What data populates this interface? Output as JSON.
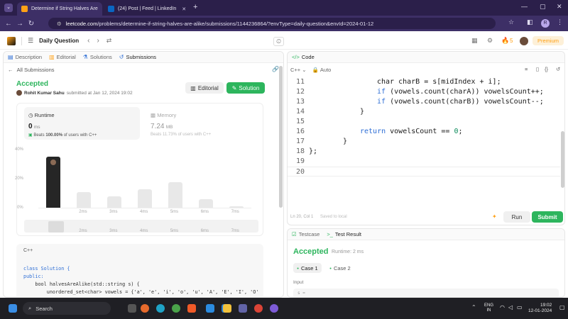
{
  "browser": {
    "tabs": [
      {
        "title": "Determine if String Halves Are",
        "color": "#ffa116"
      },
      {
        "title": "(24) Post | Feed | LinkedIn",
        "color": "#0a66c2"
      }
    ],
    "url_host": "leetcode.com",
    "url_path": "/problems/determine-if-string-halves-are-alike/submissions/1144236864/?envType=daily-question&envId=2024-01-12",
    "profile_letter": "R"
  },
  "topbar": {
    "daily_label": "Daily Question",
    "streak": "5",
    "premium_label": "Premium"
  },
  "left": {
    "tabs": {
      "description": "Description",
      "editorial": "Editorial",
      "solutions": "Solutions",
      "submissions": "Submissions"
    },
    "back_label": "All Submissions",
    "status": "Accepted",
    "author": "Rohit Kumar Sahu",
    "submitted_text": "submitted at Jan 12, 2024 19:02",
    "editorial_btn": "Editorial",
    "solution_btn": "Solution",
    "runtime": {
      "label": "Runtime",
      "value": "0",
      "unit": "ms",
      "beats_label": "Beats",
      "beats_value": "100.00%",
      "beats_suffix": "of users with C++"
    },
    "memory": {
      "label": "Memory",
      "value": "7.24",
      "unit": "MB",
      "beats_text": "Beats 11.73% of users with C++"
    },
    "chart_y": [
      "40%",
      "20%",
      "0%"
    ],
    "chart_x": [
      "2ms",
      "3ms",
      "4ms",
      "5ms",
      "6ms",
      "7ms"
    ],
    "lang": "C++",
    "code_lines": [
      "class Solution {",
      "public:",
      "    bool halvesAreAlike(std::string s) {",
      "        unordered_set<char> vowels = {'a', 'e', 'i', 'o', 'u', 'A', 'E', 'I', 'O'",
      "        int vowelsCount = 0;"
    ]
  },
  "chart_data": {
    "type": "bar",
    "categories": [
      "0ms",
      "2ms",
      "3ms",
      "4ms",
      "5ms",
      "6ms",
      "7ms"
    ],
    "values": [
      36,
      11,
      8,
      13,
      18,
      6,
      1
    ],
    "ylim": [
      0,
      40
    ],
    "ylabel": "",
    "xlabel": "",
    "highlight_index": 0
  },
  "editor": {
    "header": "Code",
    "lang": "C++",
    "auto_label": "Auto",
    "lines": [
      {
        "n": "11",
        "indent": 4,
        "tokens": [
          {
            "t": "char charB = s[midIndex + i];",
            "c": ""
          }
        ]
      },
      {
        "n": "12",
        "indent": 4,
        "tokens": [
          {
            "t": "if",
            "c": "kw"
          },
          {
            "t": " (vowels.count(charA)) vowelsCount++;",
            "c": ""
          }
        ]
      },
      {
        "n": "13",
        "indent": 4,
        "tokens": [
          {
            "t": "if",
            "c": "kw"
          },
          {
            "t": " (vowels.count(charB)) vowelsCount--;",
            "c": ""
          }
        ]
      },
      {
        "n": "14",
        "indent": 3,
        "tokens": [
          {
            "t": "}",
            "c": ""
          }
        ]
      },
      {
        "n": "15",
        "indent": 0,
        "tokens": []
      },
      {
        "n": "16",
        "indent": 3,
        "tokens": [
          {
            "t": "return",
            "c": "kw"
          },
          {
            "t": " vowelsCount == ",
            "c": ""
          },
          {
            "t": "0",
            "c": "num"
          },
          {
            "t": ";",
            "c": ""
          }
        ]
      },
      {
        "n": "17",
        "indent": 2,
        "tokens": [
          {
            "t": "}",
            "c": ""
          }
        ]
      },
      {
        "n": "18",
        "indent": 0,
        "tokens": [
          {
            "t": "};",
            "c": ""
          }
        ]
      },
      {
        "n": "19",
        "indent": 0,
        "tokens": []
      },
      {
        "n": "20",
        "indent": 0,
        "tokens": []
      }
    ],
    "cursor": "Ln 20, Col 1",
    "saved": "Saved to local",
    "run_label": "Run",
    "submit_label": "Submit"
  },
  "test": {
    "tab_testcase": "Testcase",
    "tab_result": "Test Result",
    "status": "Accepted",
    "runtime": "Runtime: 2 ms",
    "case1": "Case 1",
    "case2": "Case 2",
    "input_label": "Input",
    "input_value": "s ="
  },
  "taskbar": {
    "search_placeholder": "Search",
    "lang": "ENG",
    "region": "IN",
    "time": "19:02",
    "date": "12-01-2024"
  }
}
